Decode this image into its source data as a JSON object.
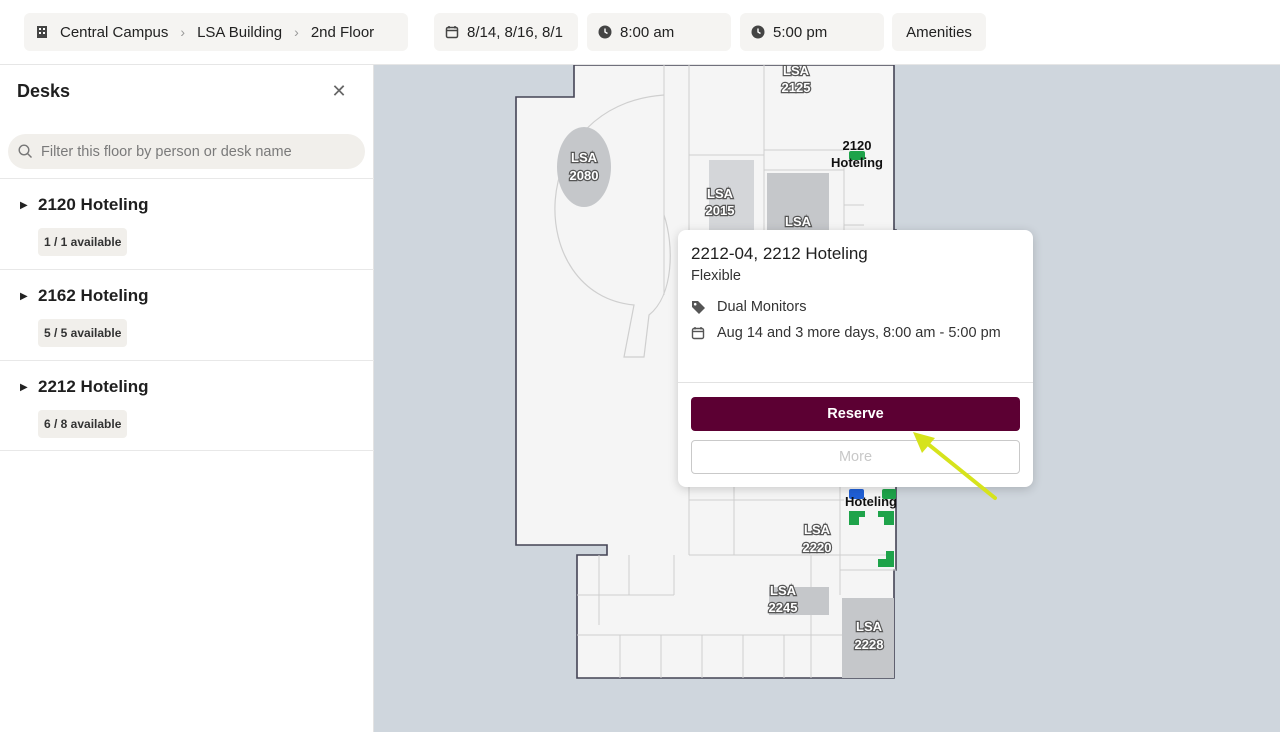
{
  "header": {
    "breadcrumb": [
      "Central Campus",
      "LSA Building",
      "2nd Floor"
    ],
    "dates": "8/14, 8/16, 8/1",
    "start_time": "8:00 am",
    "end_time": "5:00 pm",
    "amenities_label": "Amenities"
  },
  "sidebar": {
    "title": "Desks",
    "close_icon": "close-icon",
    "search_placeholder": "Filter this floor by person or desk name",
    "groups": [
      {
        "name": "2120 Hoteling",
        "availability": "1 / 1 available"
      },
      {
        "name": "2162 Hoteling",
        "availability": "5 / 5 available"
      },
      {
        "name": "2212 Hoteling",
        "availability": "6 / 8 available"
      }
    ]
  },
  "map": {
    "rooms": [
      "LSA",
      "2125",
      "LSA",
      "2080",
      "LSA",
      "2015",
      "LSA",
      "LSA",
      "2220",
      "LSA",
      "2245",
      "LSA",
      "2228"
    ],
    "hoteling_labels": [
      "2120",
      "Hoteling",
      "Hoteling"
    ],
    "desk_colors": {
      "available": "#1ea34a",
      "selected": "#1f5fd6"
    }
  },
  "popup": {
    "title": "2212-04, 2212 Hoteling",
    "type": "Flexible",
    "amenity": "Dual Monitors",
    "schedule": "Aug 14 and 3 more days, 8:00 am - 5:00 pm",
    "reserve_label": "Reserve",
    "more_label": "More"
  },
  "annotation": {
    "arrow_color": "#d6e31c"
  }
}
